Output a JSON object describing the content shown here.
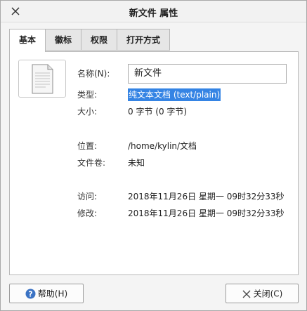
{
  "window": {
    "title": "新文件 属性"
  },
  "tabs": [
    {
      "label": "基本",
      "active": true
    },
    {
      "label": "徽标",
      "active": false
    },
    {
      "label": "权限",
      "active": false
    },
    {
      "label": "打开方式",
      "active": false
    }
  ],
  "basic": {
    "name_label": "名称(N):",
    "name_value": "新文件",
    "type_label": "类型:",
    "type_value": "纯文本文档 (text/plain)",
    "size_label": "大小:",
    "size_value": "0 字节 (0 字节)",
    "location_label": "位置:",
    "location_value": "/home/kylin/文档",
    "volume_label": "文件卷:",
    "volume_value": "未知",
    "accessed_label": "访问:",
    "accessed_value": "2018年11月26日 星期一 09时32分33秒",
    "modified_label": "修改:",
    "modified_value": "2018年11月26日 星期一 09时32分33秒"
  },
  "buttons": {
    "help_label": "帮助(H)",
    "close_label": "关闭(C)"
  },
  "icons": {
    "window_close": "close-icon",
    "file": "text-file-icon",
    "help": "help-icon",
    "close": "close-icon"
  },
  "colors": {
    "selection": "#3584e4",
    "help_icon": "#3b73c4"
  }
}
